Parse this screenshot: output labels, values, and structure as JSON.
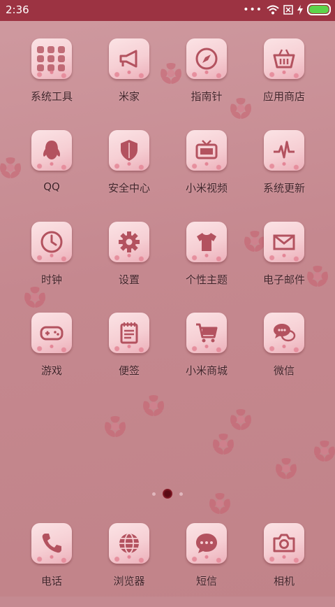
{
  "status_bar": {
    "time": "2:36"
  },
  "apps": [
    {
      "label": "系统工具",
      "icon": "folder-grid-icon"
    },
    {
      "label": "米家",
      "icon": "horn-icon"
    },
    {
      "label": "指南针",
      "icon": "compass-icon"
    },
    {
      "label": "应用商店",
      "icon": "basket-icon"
    },
    {
      "label": "QQ",
      "icon": "penguin-icon"
    },
    {
      "label": "安全中心",
      "icon": "shield-icon"
    },
    {
      "label": "小米视频",
      "icon": "tv-icon"
    },
    {
      "label": "系统更新",
      "icon": "pulse-icon"
    },
    {
      "label": "时钟",
      "icon": "clock-icon"
    },
    {
      "label": "设置",
      "icon": "gear-icon"
    },
    {
      "label": "个性主题",
      "icon": "tshirt-icon"
    },
    {
      "label": "电子邮件",
      "icon": "envelope-icon"
    },
    {
      "label": "游戏",
      "icon": "gamepad-icon"
    },
    {
      "label": "便签",
      "icon": "notepad-icon"
    },
    {
      "label": "小米商城",
      "icon": "cart-icon"
    },
    {
      "label": "微信",
      "icon": "chat-bubbles-icon"
    }
  ],
  "dock": [
    {
      "label": "电话",
      "icon": "phone-icon"
    },
    {
      "label": "浏览器",
      "icon": "globe-icon"
    },
    {
      "label": "短信",
      "icon": "message-icon"
    },
    {
      "label": "相机",
      "icon": "camera-icon"
    }
  ],
  "pager": {
    "pages": 3,
    "current": 2
  },
  "colors": {
    "status_bar": "#9c3342",
    "icon_glyph": "#b3525f",
    "wallpaper": "#c48a91"
  }
}
